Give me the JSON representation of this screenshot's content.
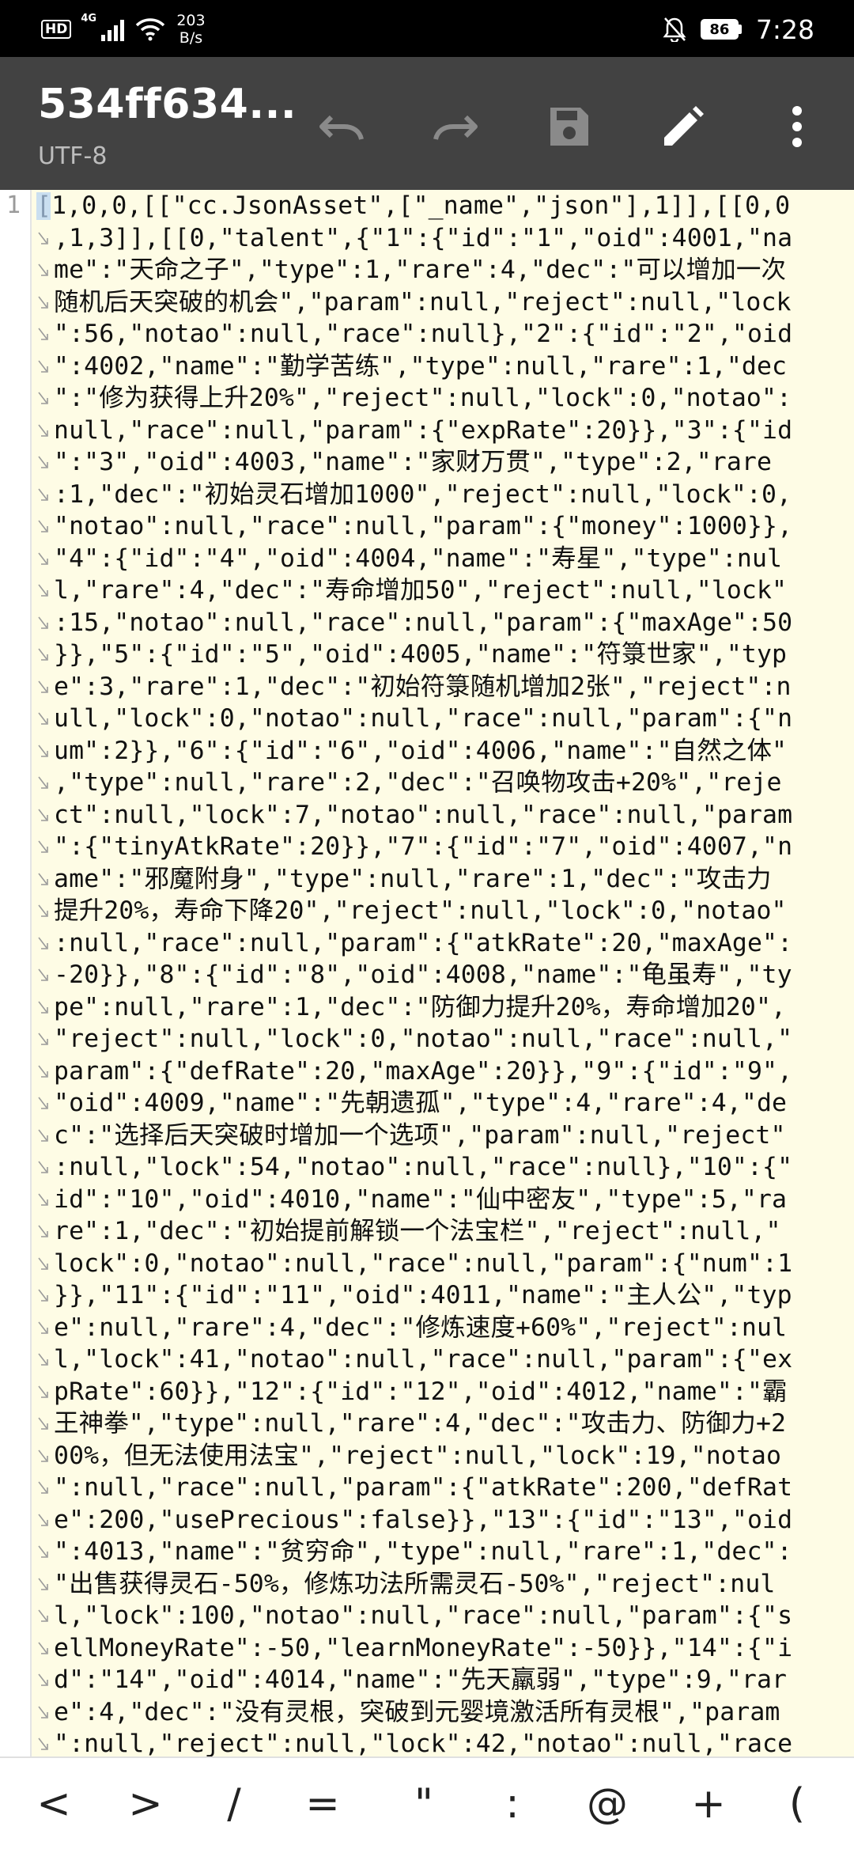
{
  "status_bar": {
    "hd_label": "HD",
    "network_label": "4G",
    "speed_value": "203",
    "speed_unit": "B/s",
    "battery": "86",
    "time": "7:28"
  },
  "app_bar": {
    "title": "534ff634...",
    "encoding": "UTF-8",
    "icons": [
      "undo-icon",
      "redo-icon",
      "save-icon",
      "edit-icon",
      "more-vert-icon"
    ]
  },
  "editor": {
    "line_number": "1",
    "visual_lines": [
      "[1,0,0,[[\"cc.JsonAsset\",[\"_name\",\"json\"],1]],[[0,0",
      ",1,3]],[[0,\"talent\",{\"1\":{\"id\":\"1\",\"oid\":4001,\"na",
      "me\":\"天命之子\",\"type\":1,\"rare\":4,\"dec\":\"可以增加一次",
      "随机后天突破的机会\",\"param\":null,\"reject\":null,\"lock",
      "\":56,\"notao\":null,\"race\":null},\"2\":{\"id\":\"2\",\"oid",
      "\":4002,\"name\":\"勤学苦练\",\"type\":null,\"rare\":1,\"dec",
      "\":\"修为获得上升20%\",\"reject\":null,\"lock\":0,\"notao\":",
      "null,\"race\":null,\"param\":{\"expRate\":20}},\"3\":{\"id",
      "\":\"3\",\"oid\":4003,\"name\":\"家财万贯\",\"type\":2,\"rare",
      ":1,\"dec\":\"初始灵石增加1000\",\"reject\":null,\"lock\":0,",
      "\"notao\":null,\"race\":null,\"param\":{\"money\":1000}},",
      "\"4\":{\"id\":\"4\",\"oid\":4004,\"name\":\"寿星\",\"type\":nul",
      "l,\"rare\":4,\"dec\":\"寿命增加50\",\"reject\":null,\"lock\"",
      ":15,\"notao\":null,\"race\":null,\"param\":{\"maxAge\":50",
      "}},\"5\":{\"id\":\"5\",\"oid\":4005,\"name\":\"符箓世家\",\"typ",
      "e\":3,\"rare\":1,\"dec\":\"初始符箓随机增加2张\",\"reject\":n",
      "ull,\"lock\":0,\"notao\":null,\"race\":null,\"param\":{\"n",
      "um\":2}},\"6\":{\"id\":\"6\",\"oid\":4006,\"name\":\"自然之体\"",
      ",\"type\":null,\"rare\":2,\"dec\":\"召唤物攻击+20%\",\"reje",
      "ct\":null,\"lock\":7,\"notao\":null,\"race\":null,\"param",
      "\":{\"tinyAtkRate\":20}},\"7\":{\"id\":\"7\",\"oid\":4007,\"n",
      "ame\":\"邪魔附身\",\"type\":null,\"rare\":1,\"dec\":\"攻击力",
      "提升20%，寿命下降20\",\"reject\":null,\"lock\":0,\"notao\"",
      ":null,\"race\":null,\"param\":{\"atkRate\":20,\"maxAge\":",
      "-20}},\"8\":{\"id\":\"8\",\"oid\":4008,\"name\":\"龟虽寿\",\"ty",
      "pe\":null,\"rare\":1,\"dec\":\"防御力提升20%，寿命增加20\",",
      "\"reject\":null,\"lock\":0,\"notao\":null,\"race\":null,\"",
      "param\":{\"defRate\":20,\"maxAge\":20}},\"9\":{\"id\":\"9\",",
      "\"oid\":4009,\"name\":\"先朝遗孤\",\"type\":4,\"rare\":4,\"de",
      "c\":\"选择后天突破时增加一个选项\",\"param\":null,\"reject\"",
      ":null,\"lock\":54,\"notao\":null,\"race\":null},\"10\":{\"",
      "id\":\"10\",\"oid\":4010,\"name\":\"仙中密友\",\"type\":5,\"ra",
      "re\":1,\"dec\":\"初始提前解锁一个法宝栏\",\"reject\":null,\"",
      "lock\":0,\"notao\":null,\"race\":null,\"param\":{\"num\":1",
      "}},\"11\":{\"id\":\"11\",\"oid\":4011,\"name\":\"主人公\",\"typ",
      "e\":null,\"rare\":4,\"dec\":\"修炼速度+60%\",\"reject\":nul",
      "l,\"lock\":41,\"notao\":null,\"race\":null,\"param\":{\"ex",
      "pRate\":60}},\"12\":{\"id\":\"12\",\"oid\":4012,\"name\":\"霸",
      "王神拳\",\"type\":null,\"rare\":4,\"dec\":\"攻击力、防御力+2",
      "00%，但无法使用法宝\",\"reject\":null,\"lock\":19,\"notao",
      "\":null,\"race\":null,\"param\":{\"atkRate\":200,\"defRat",
      "e\":200,\"usePrecious\":false}},\"13\":{\"id\":\"13\",\"oid",
      "\":4013,\"name\":\"贫穷命\",\"type\":null,\"rare\":1,\"dec\":",
      "\"出售获得灵石-50%，修炼功法所需灵石-50%\",\"reject\":nul",
      "l,\"lock\":100,\"notao\":null,\"race\":null,\"param\":{\"s",
      "ellMoneyRate\":-50,\"learnMoneyRate\":-50}},\"14\":{\"i",
      "d\":\"14\",\"oid\":4014,\"name\":\"先天羸弱\",\"type\":9,\"rar",
      "e\":4,\"dec\":\"没有灵根，突破到元婴境激活所有灵根\",\"param",
      "\":null,\"reject\":null,\"lock\":42,\"notao\":null,\"race"
    ]
  },
  "symbol_keys": [
    "<",
    ">",
    "/",
    "=",
    "\"",
    ":",
    "@",
    "+",
    "(",
    ")"
  ]
}
